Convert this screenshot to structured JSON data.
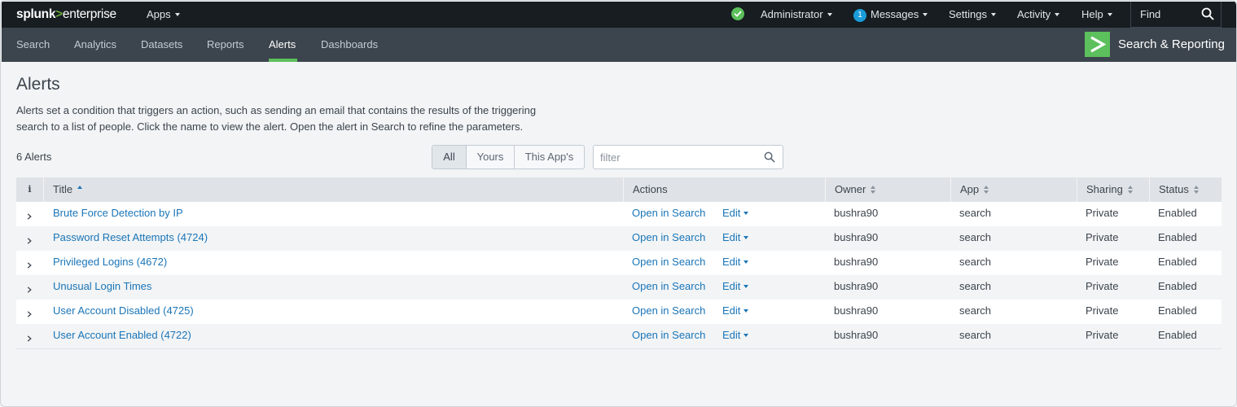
{
  "brand": {
    "part1": "splunk",
    "part2": ">",
    "part3": "enterprise"
  },
  "topbar": {
    "apps_label": "Apps",
    "status_color": "#5cc05c",
    "administrator_label": "Administrator",
    "messages_count": "1",
    "messages_label": "Messages",
    "settings_label": "Settings",
    "activity_label": "Activity",
    "help_label": "Help",
    "find_placeholder": "Find"
  },
  "appbar": {
    "tabs": [
      {
        "label": "Search"
      },
      {
        "label": "Analytics"
      },
      {
        "label": "Datasets"
      },
      {
        "label": "Reports"
      },
      {
        "label": "Alerts",
        "active": true
      },
      {
        "label": "Dashboards"
      }
    ],
    "app_name": "Search & Reporting",
    "accent": "#5cc05c"
  },
  "page": {
    "title": "Alerts",
    "description": "Alerts set a condition that triggers an action, such as sending an email that contains the results of the triggering search to a list of people. Click the name to view the alert. Open the alert in Search to refine the parameters.",
    "count_label": "6 Alerts"
  },
  "filters": {
    "segments": [
      {
        "label": "All",
        "selected": true
      },
      {
        "label": "Yours"
      },
      {
        "label": "This App's"
      }
    ],
    "filter_placeholder": "filter",
    "filter_value": ""
  },
  "table": {
    "headers": {
      "info": "i",
      "title": "Title",
      "actions": "Actions",
      "owner": "Owner",
      "app": "App",
      "sharing": "Sharing",
      "status": "Status"
    },
    "sorted_by": "title",
    "sort_direction": "ascending",
    "rows": [
      {
        "title": "Brute Force Detection by IP",
        "open": "Open in Search",
        "edit": "Edit",
        "owner": "bushra90",
        "app": "search",
        "sharing": "Private",
        "status": "Enabled"
      },
      {
        "title": "Password Reset Attempts (4724)",
        "open": "Open in Search",
        "edit": "Edit",
        "owner": "bushra90",
        "app": "search",
        "sharing": "Private",
        "status": "Enabled"
      },
      {
        "title": "Privileged Logins (4672)",
        "open": "Open in Search",
        "edit": "Edit",
        "owner": "bushra90",
        "app": "search",
        "sharing": "Private",
        "status": "Enabled"
      },
      {
        "title": "Unusual Login Times",
        "open": "Open in Search",
        "edit": "Edit",
        "owner": "bushra90",
        "app": "search",
        "sharing": "Private",
        "status": "Enabled"
      },
      {
        "title": "User Account Disabled (4725)",
        "open": "Open in Search",
        "edit": "Edit",
        "owner": "bushra90",
        "app": "search",
        "sharing": "Private",
        "status": "Enabled"
      },
      {
        "title": "User Account Enabled (4722)",
        "open": "Open in Search",
        "edit": "Edit",
        "owner": "bushra90",
        "app": "search",
        "sharing": "Private",
        "status": "Enabled"
      }
    ]
  },
  "colors": {
    "topbar_bg": "#171d21",
    "appbar_bg": "#3c444d",
    "link": "#1a75b8",
    "page_bg": "#f2f4f5"
  }
}
